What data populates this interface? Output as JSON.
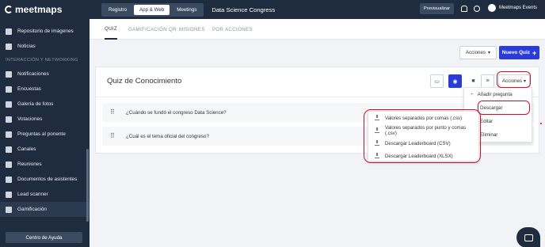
{
  "brand": {
    "logo_text": "meetmaps"
  },
  "sidebar": {
    "items_top": [
      {
        "label": "Repositorio de imágenes",
        "icon": "image-folder-icon"
      },
      {
        "label": "Noticias",
        "icon": "news-icon"
      }
    ],
    "section_label": "INTERACCIÓN Y NETWORKING",
    "items": [
      {
        "label": "Notificaciones",
        "icon": "bell-icon"
      },
      {
        "label": "Encuestas",
        "icon": "poll-icon"
      },
      {
        "label": "Galería de fotos",
        "icon": "photo-gallery-icon"
      },
      {
        "label": "Votaciones",
        "icon": "vote-icon"
      },
      {
        "label": "Preguntas al ponente",
        "icon": "question-icon"
      },
      {
        "label": "Canales",
        "icon": "channel-icon"
      },
      {
        "label": "Reuniones",
        "icon": "meeting-icon"
      },
      {
        "label": "Documentos de asistentes",
        "icon": "documents-icon"
      },
      {
        "label": "Lead scanner",
        "icon": "scanner-icon"
      },
      {
        "label": "Gamificación",
        "icon": "trophy-icon",
        "active": true
      }
    ],
    "help_label": "Centro de Ayuda"
  },
  "topbar": {
    "segments": [
      "Registro",
      "App & Web",
      "Meetings"
    ],
    "active_segment": "App & Web",
    "event_title": "Data Science Congress",
    "preview_label": "Previsualizar",
    "user_name": "Meetmaps Events"
  },
  "tabs": [
    "QUIZ",
    "GAMIFICACIÓN QR",
    "MISIONES",
    "POR ACCIONES"
  ],
  "actions": {
    "acciones_label": "Acciones",
    "new_quiz_label": "Nuevo Quiz"
  },
  "card": {
    "title": "Quiz de Conocimiento",
    "acciones_label": "Acciones",
    "questions": [
      "¿Cuándo se fundó el congreso Data Science?",
      "¿Cuál es el tema oficial del congreso?"
    ]
  },
  "menu": {
    "items": [
      "Añadir pregunta",
      "Descargar",
      "Editar",
      "Eliminar"
    ]
  },
  "submenu": {
    "items": [
      "Valores separados por comas (.csv)",
      "Valores separados por punto y comas (.csv)",
      "Descargar Leaderboard (CSV)",
      "Descargar Leaderboard (XLSX)"
    ]
  },
  "colors": {
    "sidebar": "#1f2c3f",
    "accent": "#2a3bd6",
    "annotation": "#c8102e"
  }
}
